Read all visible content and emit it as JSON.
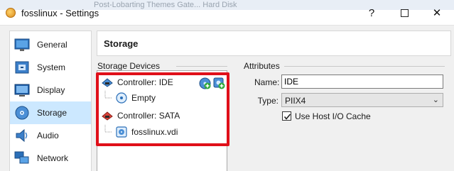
{
  "background_window": {
    "title": "Post-Lobarting Themes Gate... Hard Disk"
  },
  "window": {
    "title": "fosslinux - Settings",
    "help": "?",
    "close": "✕"
  },
  "sidebar": {
    "items": [
      {
        "label": "General",
        "icon": "general-icon"
      },
      {
        "label": "System",
        "icon": "system-icon"
      },
      {
        "label": "Display",
        "icon": "display-icon"
      },
      {
        "label": "Storage",
        "icon": "storage-icon",
        "selected": true
      },
      {
        "label": "Audio",
        "icon": "audio-icon"
      },
      {
        "label": "Network",
        "icon": "network-icon"
      }
    ]
  },
  "page": {
    "title": "Storage"
  },
  "storage_devices": {
    "heading": "Storage Devices",
    "tree": [
      {
        "label": "Controller: IDE",
        "kind": "controller",
        "icon": "ide-controller-icon"
      },
      {
        "label": "Empty",
        "kind": "optical",
        "icon": "optical-disk-icon"
      },
      {
        "label": "Controller: SATA",
        "kind": "controller",
        "icon": "sata-controller-icon"
      },
      {
        "label": "fosslinux.vdi",
        "kind": "disk",
        "icon": "hard-disk-icon"
      }
    ]
  },
  "attributes": {
    "heading": "Attributes",
    "name_label": "Name:",
    "name_value": "IDE",
    "type_label": "Type:",
    "type_value": "PIIX4",
    "host_io_cache_label": "Use Host I/O Cache",
    "host_io_cache_checked": true
  },
  "colors": {
    "selection": "#cce8ff",
    "highlight": "#e0101a",
    "add_green": "#2fa83a"
  }
}
